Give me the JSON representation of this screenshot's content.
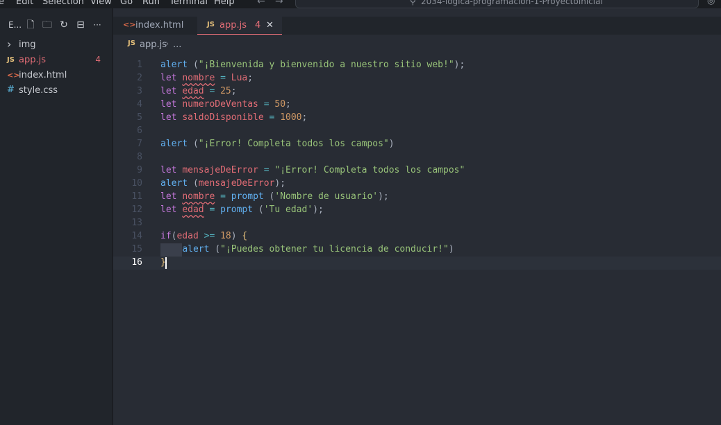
{
  "menu": {
    "items": [
      "e",
      "Edit",
      "Selection",
      "View",
      "Go",
      "Run",
      "Terminal",
      "Help"
    ],
    "back_arrow": "←",
    "forward_arrow": "→",
    "search_icon": "⚲",
    "command_center": "2034-logica-programacion-1-ProyectoInicial",
    "copilot_icon": "◎"
  },
  "explorer": {
    "title": "E...",
    "tools": [
      "new-file-icon",
      "new-folder-icon",
      "refresh-icon",
      "collapse-icon",
      "more-icon"
    ],
    "tool_glyphs": [
      "🗋",
      "🗀",
      "↻",
      "⊟",
      "···"
    ],
    "items": [
      {
        "name": "img",
        "icon": "›",
        "icon_color": "#c5c8ce",
        "label_color": "#c5c8ce",
        "badge": ""
      },
      {
        "name": "app.js",
        "icon": "JS",
        "icon_color": "#e5c07b",
        "label_color": "#e06c75",
        "badge": "4"
      },
      {
        "name": "index.html",
        "icon": "<>",
        "icon_color": "#e06c4b",
        "label_color": "#c5c8ce",
        "badge": ""
      },
      {
        "name": "style.css",
        "icon": "#",
        "icon_color": "#519aba",
        "label_color": "#c5c8ce",
        "badge": ""
      }
    ]
  },
  "tabs": [
    {
      "label": "index.html",
      "icon": "<>",
      "active": false
    },
    {
      "label": "app.js",
      "icon": "JS",
      "badge": "4",
      "close": "✕",
      "active": true
    }
  ],
  "breadcrumb": {
    "icon": "JS",
    "file": "app.js",
    "separator": "›",
    "more": "..."
  },
  "editor": {
    "current_line": 16,
    "lines": [
      {
        "n": "1",
        "tokens": [
          [
            "fn",
            "alert"
          ],
          [
            "pn",
            " ("
          ],
          [
            "st",
            "\"¡Bienvenida y bienvenido a nuestro sitio web!\""
          ],
          [
            "pn",
            ");"
          ]
        ]
      },
      {
        "n": "2",
        "tokens": [
          [
            "kw",
            "let"
          ],
          [
            "pn",
            " "
          ],
          [
            "vr-sq",
            "nombre"
          ],
          [
            "pn",
            " "
          ],
          [
            "op",
            "="
          ],
          [
            "pn",
            " "
          ],
          [
            "vr",
            "Lua"
          ],
          [
            "pn",
            ";"
          ]
        ]
      },
      {
        "n": "3",
        "tokens": [
          [
            "kw",
            "let"
          ],
          [
            "pn",
            " "
          ],
          [
            "vr-sq",
            "edad"
          ],
          [
            "pn",
            " "
          ],
          [
            "op",
            "="
          ],
          [
            "pn",
            " "
          ],
          [
            "nm",
            "25"
          ],
          [
            "pn",
            ";"
          ]
        ]
      },
      {
        "n": "4",
        "tokens": [
          [
            "kw",
            "let"
          ],
          [
            "pn",
            " "
          ],
          [
            "vr",
            "numeroDeVentas"
          ],
          [
            "pn",
            " "
          ],
          [
            "op",
            "="
          ],
          [
            "pn",
            " "
          ],
          [
            "nm",
            "50"
          ],
          [
            "pn",
            ";"
          ]
        ]
      },
      {
        "n": "5",
        "tokens": [
          [
            "kw",
            "let"
          ],
          [
            "pn",
            " "
          ],
          [
            "vr",
            "saldoDisponible"
          ],
          [
            "pn",
            " "
          ],
          [
            "op",
            "="
          ],
          [
            "pn",
            " "
          ],
          [
            "nm",
            "1000"
          ],
          [
            "pn",
            ";"
          ]
        ]
      },
      {
        "n": "6",
        "tokens": []
      },
      {
        "n": "7",
        "tokens": [
          [
            "fn",
            "alert"
          ],
          [
            "pn",
            " ("
          ],
          [
            "st",
            "\"¡Error! Completa todos los campos\""
          ],
          [
            "pn",
            ")"
          ]
        ]
      },
      {
        "n": "8",
        "tokens": []
      },
      {
        "n": "9",
        "tokens": [
          [
            "kw",
            "let"
          ],
          [
            "pn",
            " "
          ],
          [
            "vr",
            "mensajeDeError"
          ],
          [
            "pn",
            " "
          ],
          [
            "op",
            "="
          ],
          [
            "pn",
            " "
          ],
          [
            "st",
            "\"¡Error! Completa todos los campos\""
          ]
        ]
      },
      {
        "n": "10",
        "tokens": [
          [
            "fn",
            "alert"
          ],
          [
            "pn",
            " ("
          ],
          [
            "vr",
            "mensajeDeError"
          ],
          [
            "pn",
            ");"
          ]
        ]
      },
      {
        "n": "11",
        "tokens": [
          [
            "kw",
            "let"
          ],
          [
            "pn",
            " "
          ],
          [
            "vr-sq",
            "nombre"
          ],
          [
            "pn",
            " "
          ],
          [
            "op",
            "="
          ],
          [
            "pn",
            " "
          ],
          [
            "fn",
            "prompt"
          ],
          [
            "pn",
            " ("
          ],
          [
            "st",
            "'Nombre de usuario'"
          ],
          [
            "pn",
            ");"
          ]
        ]
      },
      {
        "n": "12",
        "tokens": [
          [
            "kw",
            "let"
          ],
          [
            "pn",
            " "
          ],
          [
            "vr-sq",
            "edad"
          ],
          [
            "pn",
            " "
          ],
          [
            "op",
            "="
          ],
          [
            "pn",
            " "
          ],
          [
            "fn",
            "prompt"
          ],
          [
            "pn",
            " ("
          ],
          [
            "st",
            "'Tu edad'"
          ],
          [
            "pn",
            ");"
          ]
        ]
      },
      {
        "n": "13",
        "tokens": []
      },
      {
        "n": "14",
        "tokens": [
          [
            "kw",
            "if"
          ],
          [
            "pn",
            "("
          ],
          [
            "vr",
            "edad"
          ],
          [
            "pn",
            " "
          ],
          [
            "op",
            ">="
          ],
          [
            "pn",
            " "
          ],
          [
            "nm",
            "18"
          ],
          [
            "pn",
            ") "
          ],
          [
            "br",
            "{"
          ]
        ]
      },
      {
        "n": "15",
        "tokens": [
          [
            "pn",
            "    "
          ],
          [
            "fn",
            "alert"
          ],
          [
            "pn",
            " ("
          ],
          [
            "st",
            "\"¡Puedes obtener tu licencia de conducir!\""
          ],
          [
            "pn",
            ")"
          ]
        ]
      },
      {
        "n": "16",
        "tokens": [
          [
            "br",
            "}"
          ]
        ]
      }
    ]
  },
  "colors": {
    "background": "#282c34",
    "sidebar": "#21252b",
    "accent_error": "#e06c75",
    "keyword": "#c678dd",
    "function": "#61afef",
    "string": "#98c379",
    "number": "#d19a66"
  }
}
